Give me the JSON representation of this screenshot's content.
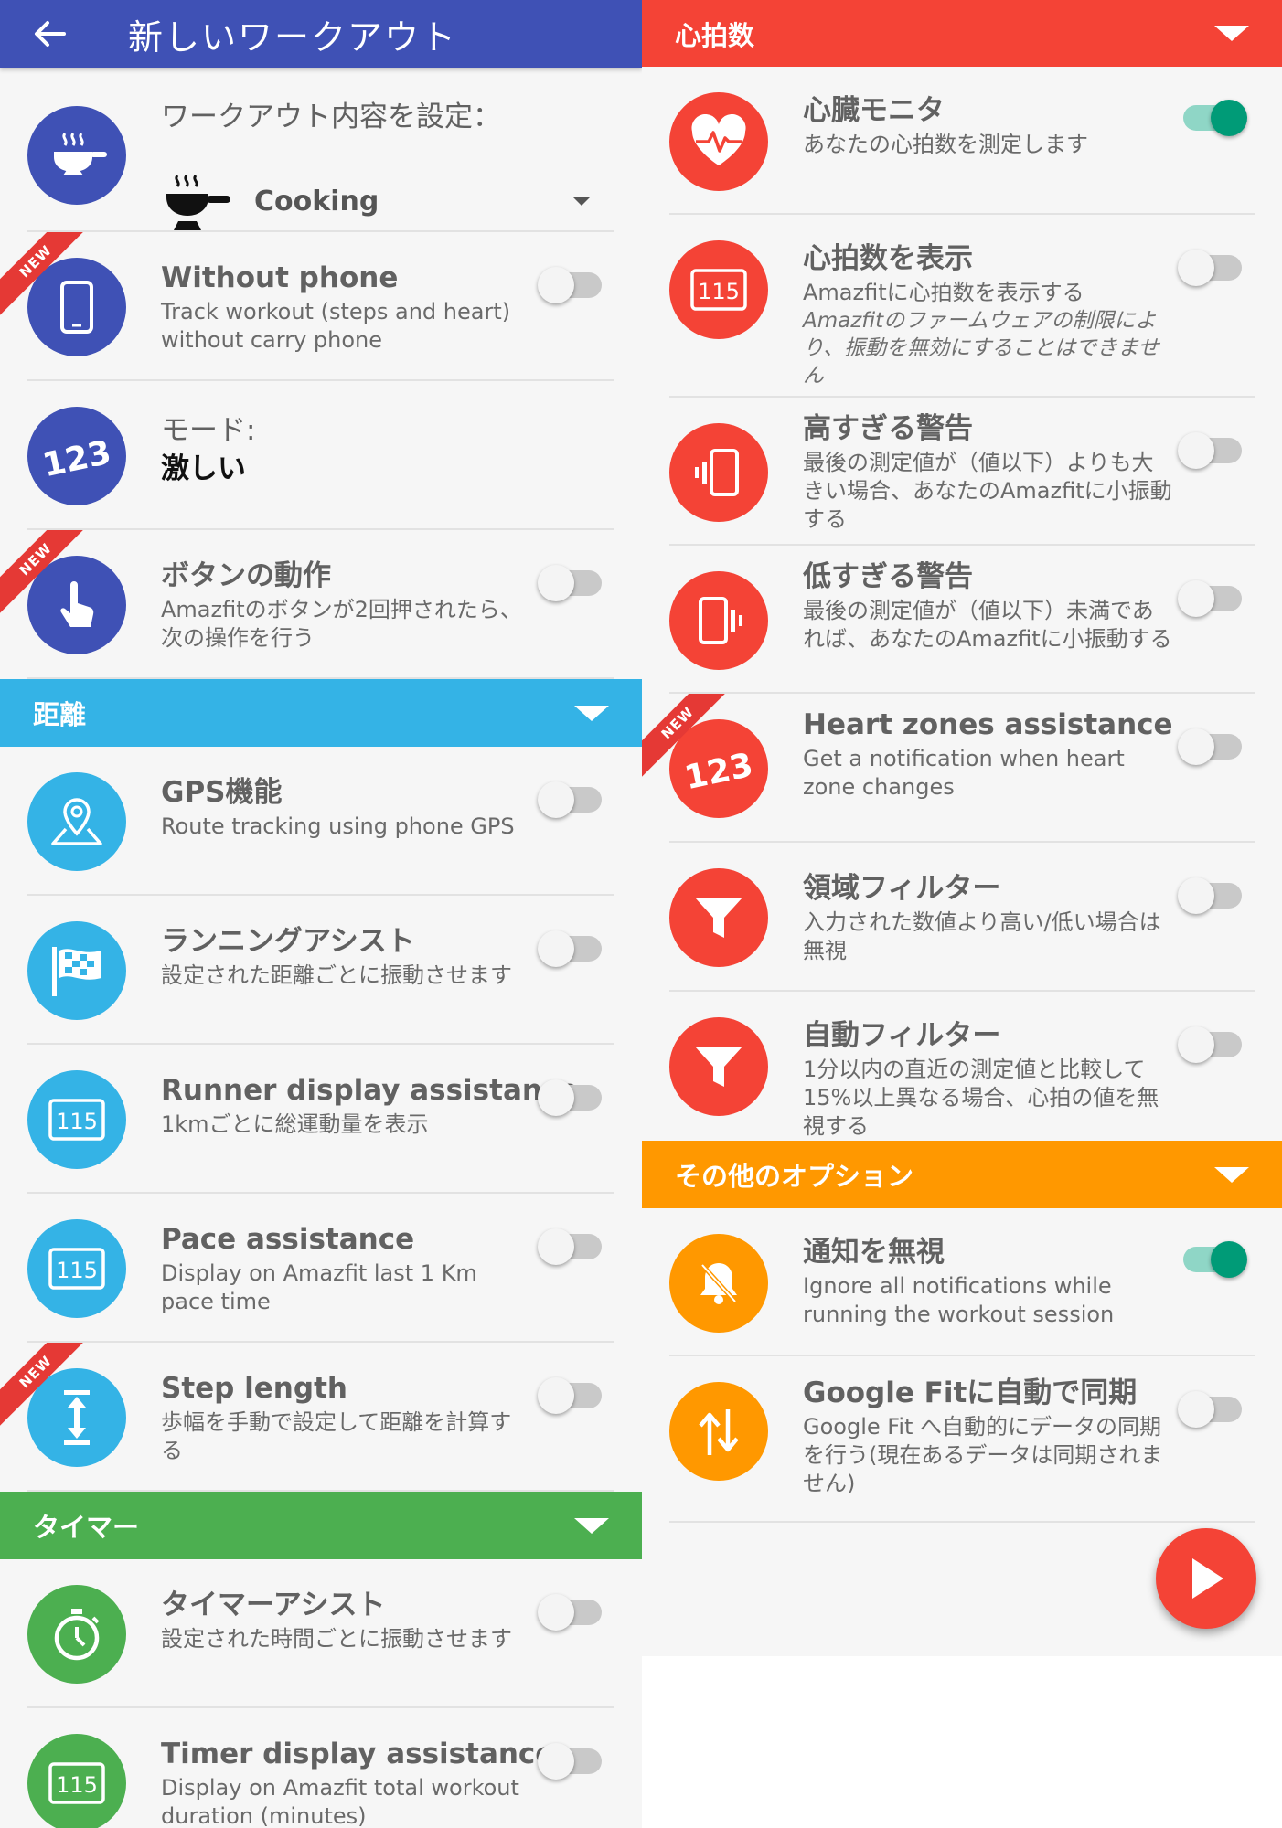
{
  "header": {
    "title": "新しいワークアウト"
  },
  "workout": {
    "label": "ワークアウト内容を設定：",
    "selected": "Cooking"
  },
  "rows": {
    "without_phone": {
      "title": "Without phone",
      "sub": "Track workout (steps and heart) without carry phone",
      "badge": "NEW",
      "enabled": false
    },
    "mode": {
      "title": "モード:",
      "value": "激しい"
    },
    "button_action": {
      "title": "ボタンの動作",
      "sub": "Amazfitのボタンが2回押されたら、次の操作を行う",
      "badge": "NEW",
      "enabled": false
    },
    "gps": {
      "title": "GPS機能",
      "sub": "Route tracking using phone GPS",
      "enabled": false
    },
    "running_assist": {
      "title": "ランニングアシスト",
      "sub": "設定された距離ごとに振動させます",
      "enabled": false
    },
    "runner_display": {
      "title": "Runner display assistance",
      "sub": "1kmごとに総運動量を表示",
      "enabled": false
    },
    "pace": {
      "title": "Pace assistance",
      "sub": "Display on Amazfit last 1 Km pace time",
      "enabled": false
    },
    "step_length": {
      "title": "Step length",
      "sub": "歩幅を手動で設定して距離を計算する",
      "badge": "NEW",
      "enabled": false
    },
    "timer_assist": {
      "title": "タイマーアシスト",
      "sub": "設定された時間ごとに振動させます",
      "enabled": false
    },
    "timer_display": {
      "title": "Timer display assistance",
      "sub": "Display on Amazfit total workout duration (minutes)",
      "enabled": false
    },
    "heart_monitor": {
      "title": "心臓モニタ",
      "sub": "あなたの心拍数を測定します",
      "enabled": true
    },
    "show_hr": {
      "title": "心拍数を表示",
      "sub": "Amazfitに心拍数を表示する",
      "note": "Amazfitのファームウェアの制限により、振動を無効にすることはできません",
      "enabled": false
    },
    "high_alert": {
      "title": "高すぎる警告",
      "sub": "最後の測定値が（値以下）よりも大きい場合、あなたのAmazfitに小振動する",
      "enabled": false
    },
    "low_alert": {
      "title": "低すぎる警告",
      "sub": "最後の測定値が（値以下）未満であれば、あなたのAmazfitに小振動する",
      "enabled": false
    },
    "heart_zones": {
      "title": "Heart zones assistance",
      "sub": "Get a notification when heart zone changes",
      "badge": "NEW",
      "enabled": false
    },
    "range_filter": {
      "title": "領域フィルター",
      "sub": "入力された数値より高い/低い場合は無視",
      "enabled": false
    },
    "auto_filter": {
      "title": "自動フィルター",
      "sub": "1分以内の直近の測定値と比較して15%以上異なる場合、心拍の値を無視する",
      "enabled": false
    },
    "ignore_notif": {
      "title": "通知を無視",
      "sub": "Ignore all notifications while running the workout session",
      "enabled": true
    },
    "google_fit": {
      "title": "Google Fitに自動で同期",
      "sub": "Google Fit へ自動的にデータの同期を行う(現在あるデータは同期されません)",
      "enabled": false
    }
  },
  "sections": {
    "distance": "距離",
    "timer": "タイマー",
    "heart_rate": "心拍数",
    "other": "その他のオプション"
  },
  "icon_text": {
    "num123": "123",
    "num115": "115"
  },
  "colors": {
    "indigo": "#3f51b5",
    "blue": "#34b3e6",
    "green": "#4caf50",
    "red": "#f44336",
    "orange": "#ff9800",
    "toggle_on": "#009b77"
  }
}
